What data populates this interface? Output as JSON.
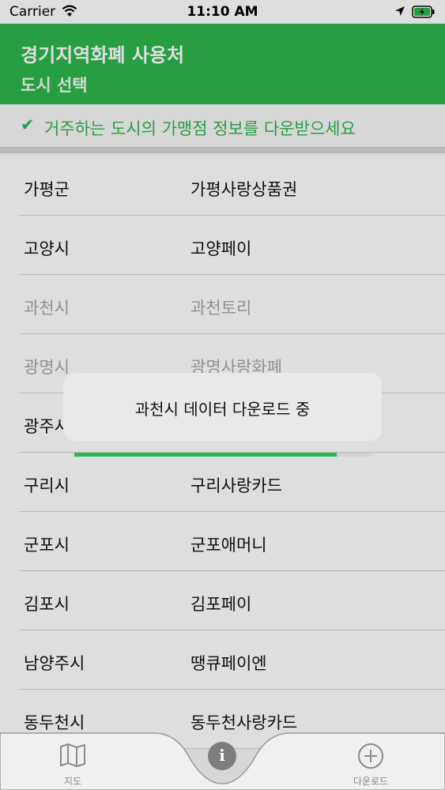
{
  "status_bar": {
    "carrier": "Carrier",
    "time": "11:10 AM"
  },
  "header": {
    "title": "경기지역화폐 사용처",
    "subtitle": "도시 선택"
  },
  "notice": {
    "check": "✔",
    "text": "거주하는 도시의 가맹점 정보를 다운받으세요"
  },
  "cities": [
    {
      "city": "가평군",
      "currency": "가평사랑상품권",
      "dim": false
    },
    {
      "city": "고양시",
      "currency": "고양페이",
      "dim": false
    },
    {
      "city": "과천시",
      "currency": "과천토리",
      "dim": true
    },
    {
      "city": "광명시",
      "currency": "광명사랑화폐",
      "dim": true
    },
    {
      "city": "광주시",
      "currency": "",
      "dim": false
    },
    {
      "city": "구리시",
      "currency": "구리사랑카드",
      "dim": false
    },
    {
      "city": "군포시",
      "currency": "군포애머니",
      "dim": false
    },
    {
      "city": "김포시",
      "currency": "김포페이",
      "dim": false
    },
    {
      "city": "남양주시",
      "currency": "땡큐페이엔",
      "dim": false
    },
    {
      "city": "동두천시",
      "currency": "동두천사랑카드",
      "dim": false
    }
  ],
  "dialog": {
    "message": "과천시 데이터 다운로드 중",
    "progress_percent": 88
  },
  "tabs": [
    {
      "label": "지도",
      "icon": "map-icon"
    },
    {
      "label": "",
      "icon": "info-icon",
      "glyph": "i"
    },
    {
      "label": "다운로드",
      "icon": "plus-circle-icon"
    }
  ],
  "colors": {
    "brand_green": "#2fb64e",
    "dim_text": "#a8a8a8"
  }
}
